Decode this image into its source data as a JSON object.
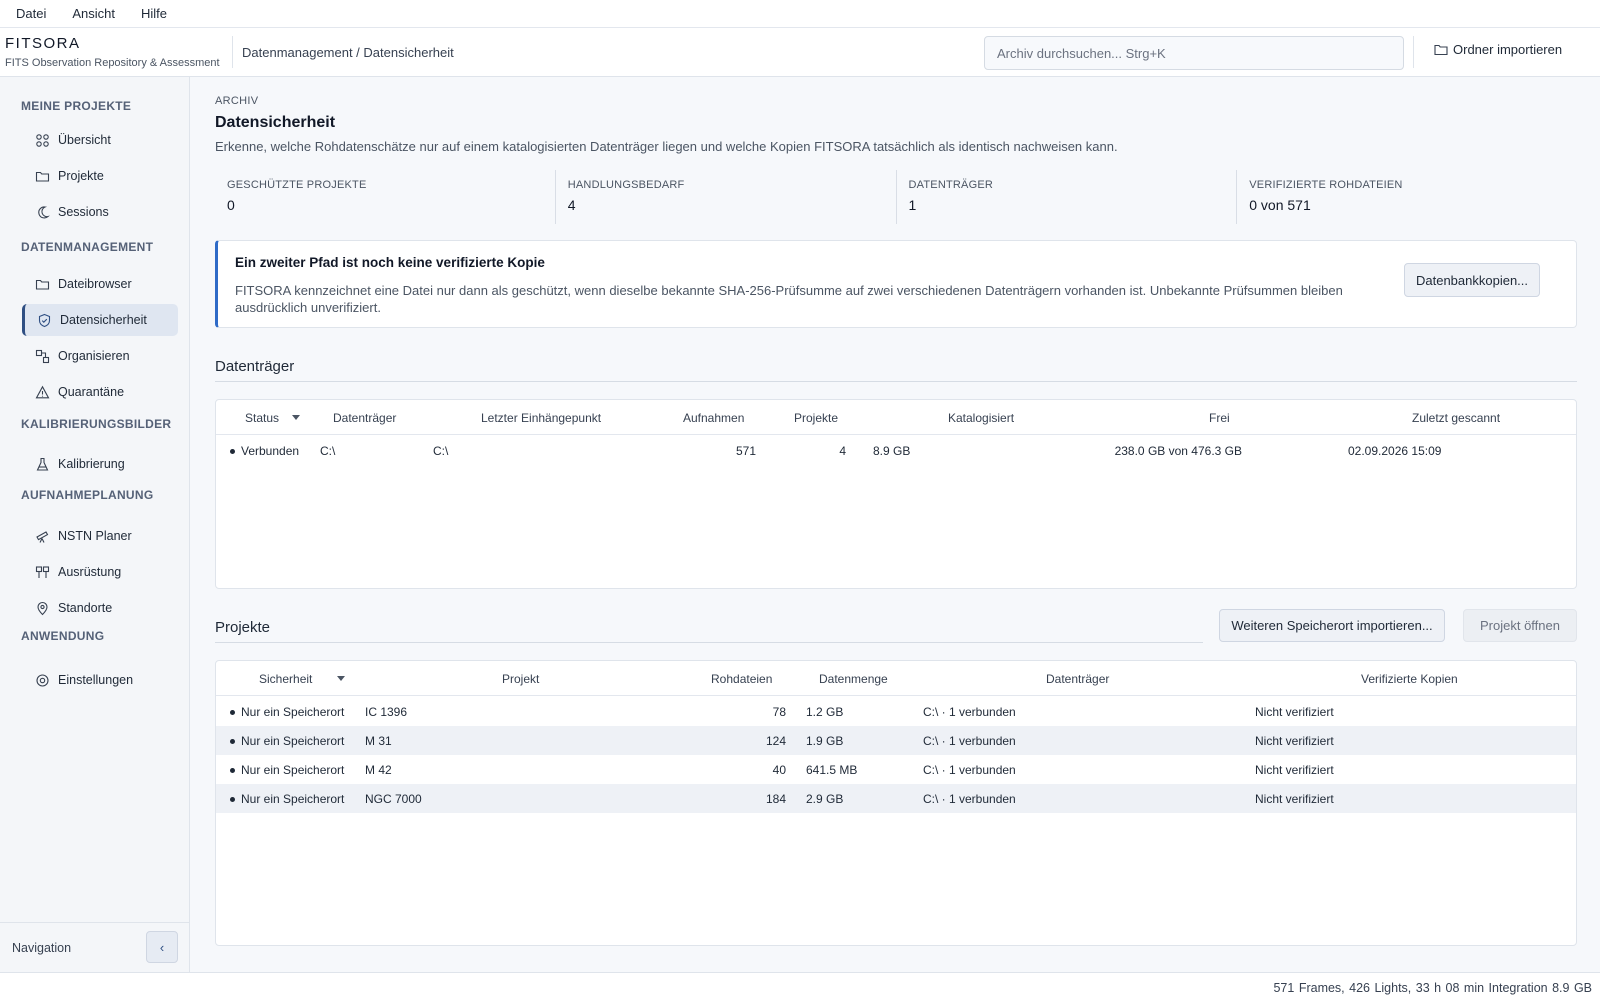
{
  "menu": {
    "file": "Datei",
    "view": "Ansicht",
    "help": "Hilfe"
  },
  "header": {
    "app_name": "FITSORA",
    "app_subtitle": "FITS Observation Repository & Assessment",
    "breadcrumb": "Datenmanagement / Datensicherheit",
    "search_placeholder": "Archiv durchsuchen...  Strg+K",
    "import_folder": "Ordner importieren"
  },
  "sidebar": {
    "sections": {
      "my_projects": "MEINE PROJEKTE",
      "data_management": "DATENMANAGEMENT",
      "calibration": "KALIBRIERUNGSBILDER",
      "planning": "AUFNAHMEPLANUNG",
      "application": "ANWENDUNG"
    },
    "items": {
      "overview": "Übersicht",
      "projects": "Projekte",
      "sessions": "Sessions",
      "file_browser": "Dateibrowser",
      "data_security": "Datensicherheit",
      "organize": "Organisieren",
      "quarantine": "Quarantäne",
      "calibration": "Kalibrierung",
      "nstn_planner": "NSTN Planer",
      "equipment": "Ausrüstung",
      "locations": "Standorte",
      "settings": "Einstellungen"
    },
    "footer_label": "Navigation",
    "collapse": "‹"
  },
  "main": {
    "eyebrow": "ARCHIV",
    "title": "Datensicherheit",
    "description": "Erkenne, welche Rohdatenschätze nur auf einem katalogisierten Datenträger liegen und welche Kopien FITSORA tatsächlich als identisch nachweisen kann.",
    "stats": [
      {
        "label": "GESCHÜTZTE PROJEKTE",
        "value": "0"
      },
      {
        "label": "HANDLUNGSBEDARF",
        "value": "4"
      },
      {
        "label": "DATENTRÄGER",
        "value": "1"
      },
      {
        "label": "VERIFIZIERTE ROHDATEIEN",
        "value": "0 von 571"
      }
    ],
    "notice": {
      "title": "Ein zweiter Pfad ist noch keine verifizierte Kopie",
      "body": "FITSORA kennzeichnet eine Datei nur dann als geschützt, wenn dieselbe bekannte SHA-256-Prüfsumme auf zwei verschiedenen Datenträgern vorhanden ist. Unbekannte Prüfsummen bleiben ausdrücklich unverifiziert.",
      "button": "Datenbankkopien..."
    },
    "drives": {
      "title": "Datenträger",
      "columns": [
        "Status",
        "Datenträger",
        "Letzter Einhängepunkt",
        "Aufnahmen",
        "Projekte",
        "Katalogisiert",
        "Frei",
        "Zuletzt gescannt"
      ],
      "rows": [
        {
          "status": "Verbunden",
          "drive": "C:\\",
          "mount": "C:\\",
          "frames": "571",
          "projects": "4",
          "cataloged": "8.9 GB",
          "free": "238.0 GB von 476.3 GB",
          "scanned": "02.09.2026 15:09"
        }
      ]
    },
    "projects": {
      "title": "Projekte",
      "import_button": "Weiteren Speicherort importieren...",
      "open_button": "Projekt öffnen",
      "columns": [
        "Sicherheit",
        "Projekt",
        "Rohdateien",
        "Datenmenge",
        "Datenträger",
        "Verifizierte Kopien"
      ],
      "rows": [
        {
          "security": "Nur ein Speicherort",
          "project": "IC 1396",
          "raw": "78",
          "size": "1.2 GB",
          "drive": "C:\\ · 1 verbunden",
          "verified": "Nicht verifiziert"
        },
        {
          "security": "Nur ein Speicherort",
          "project": "M 31",
          "raw": "124",
          "size": "1.9 GB",
          "drive": "C:\\ · 1 verbunden",
          "verified": "Nicht verifiziert"
        },
        {
          "security": "Nur ein Speicherort",
          "project": "M 42",
          "raw": "40",
          "size": "641.5 MB",
          "drive": "C:\\ · 1 verbunden",
          "verified": "Nicht verifiziert"
        },
        {
          "security": "Nur ein Speicherort",
          "project": "NGC 7000",
          "raw": "184",
          "size": "2.9 GB",
          "drive": "C:\\ · 1 verbunden",
          "verified": "Nicht verifiziert"
        }
      ]
    }
  },
  "statusbar": {
    "text": "571 Frames, 426 Lights, 33 h 08 min Integration  8.9 GB"
  },
  "colors": {
    "accent": "#2f6bc7",
    "active_nav": "#dfe6f1",
    "navy": "#2f4f83"
  }
}
